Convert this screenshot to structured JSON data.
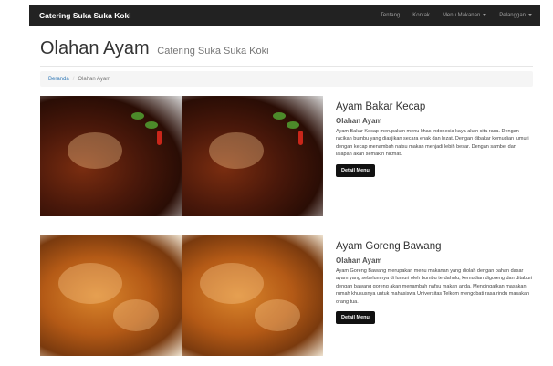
{
  "navbar": {
    "brand": "Catering Suka Suka Koki",
    "links": [
      "Tentang",
      "Kontak",
      "Menu Makanan",
      "Pelanggan"
    ]
  },
  "header": {
    "title": "Olahan Ayam",
    "subtitle": "Catering Suka Suka Koki"
  },
  "breadcrumb": {
    "home": "Beranda",
    "separator": "/",
    "current": "Olahan Ayam"
  },
  "items": [
    {
      "title": "Ayam Bakar Kecap",
      "category": "Olahan Ayam",
      "description": "Ayam Bakar Kecap merupakan menu khas indonesia kaya akan cita rasa. Dengan racikan bumbu yang diasjikan secara enak dan lezat. Dengan dibakar kemudian lumuri dengan kecap menambah nafsu makan menjadi lebih besar. Dengan sambel dan lalapan akan semakin nikmat.",
      "button": "Detail Menu"
    },
    {
      "title": "Ayam Goreng Bawang",
      "category": "Olahan Ayam",
      "description": "Ayam Goreng Bawang merupakan menu makanan yang diolah dengan bahan dasar ayam yang sebelumnya di lumuri oleh bumbu terdahulu, kemudian digoreng dan ditaburi dengan bawang goreng akan menambah nafsu makan anda. Mengingatkan masakan rumah khususnya untuk mahasiswa Universitas Telkom mengobati rasa rindu masakan orang tua.",
      "button": "Detail Menu"
    }
  ]
}
